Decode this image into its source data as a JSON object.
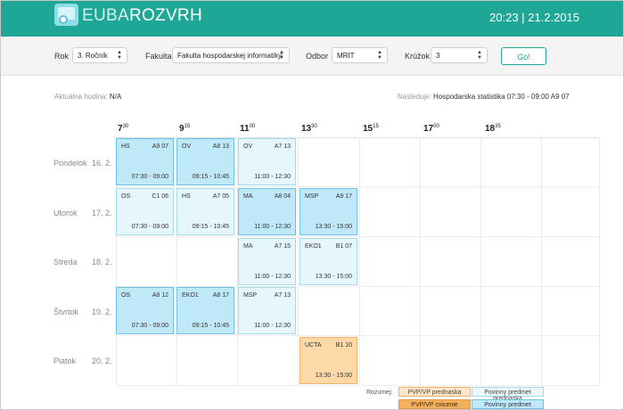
{
  "header": {
    "brand_light": "EUBA",
    "brand_bold": "ROZVRH",
    "clock": "20:23 | 21.2.2015",
    "colors": {
      "bar": "#1ea696"
    }
  },
  "filters": {
    "rok_label": "Rok",
    "rok_value": "3. Ročník",
    "fakulta_label": "Fakulta",
    "fakulta_value": "Fakulta hospodarskej informatiky",
    "odbor_label": "Odbor",
    "odbor_value": "MRIT",
    "kruzok_label": "Krúžok",
    "kruzok_value": "3",
    "go_label": "Go!"
  },
  "info": {
    "current_label": "Aktuálna hodina:",
    "current_value": "N/A",
    "next_label": "Nasleduje:",
    "next_value": "Hospodarska statistika 07:30 - 09:00 A9 07"
  },
  "times": [
    {
      "h": "7",
      "m": "30"
    },
    {
      "h": "9",
      "m": "15"
    },
    {
      "h": "11",
      "m": "00"
    },
    {
      "h": "13",
      "m": "30"
    },
    {
      "h": "15",
      "m": "15"
    },
    {
      "h": "17",
      "m": "00"
    },
    {
      "h": "18",
      "m": "35"
    }
  ],
  "days": [
    {
      "name": "Pondelok",
      "date": "16. 2."
    },
    {
      "name": "Utorok",
      "date": "17. 2."
    },
    {
      "name": "Streda",
      "date": "18. 2."
    },
    {
      "name": "Štvrtok",
      "date": "19. 2."
    },
    {
      "name": "Piatok",
      "date": "20. 2."
    }
  ],
  "lessons": [
    {
      "subject": "HS",
      "room": "A9 07",
      "time": "07:30 - 09:00"
    },
    {
      "subject": "OV",
      "room": "A8 13",
      "time": "09:15 - 10:45"
    },
    {
      "subject": "OV",
      "room": "A7 13",
      "time": "11:00 - 12:30"
    },
    {
      "subject": "OS",
      "room": "C1 06",
      "time": "07:30 - 09:00"
    },
    {
      "subject": "HS",
      "room": "A7 05",
      "time": "09:15 - 10:45"
    },
    {
      "subject": "MA",
      "room": "A8 04",
      "time": "11:00 - 12:30"
    },
    {
      "subject": "MSP",
      "room": "A9 17",
      "time": "13:30 - 15:00"
    },
    {
      "subject": "MA",
      "room": "A7 15",
      "time": "11:00 - 12:30"
    },
    {
      "subject": "EKO1",
      "room": "B1 07",
      "time": "13:30 - 15:00"
    },
    {
      "subject": "OS",
      "room": "A8 12",
      "time": "07:30 - 09:00"
    },
    {
      "subject": "EKO1",
      "room": "A8 17",
      "time": "09:15 - 10:45"
    },
    {
      "subject": "MSP",
      "room": "A7 13",
      "time": "11:00 - 12:30"
    },
    {
      "subject": "UCTA",
      "room": "B1 10",
      "time": "13:30 - 15:00"
    }
  ],
  "legend": {
    "label": "Rozumej:",
    "opt_lecture": "PVP/VP prednaska",
    "opt_practice": "PVP/VP cvicenie",
    "req_lecture": "Povinny predmet prednaska",
    "req_practice": "Povinny predmet cvicenie",
    "colors": {
      "opt_lecture": "#fde7c8",
      "opt_practice": "#f5b05d",
      "req_lecture": "#eaf7fd",
      "req_practice": "#bfe8f8"
    }
  }
}
